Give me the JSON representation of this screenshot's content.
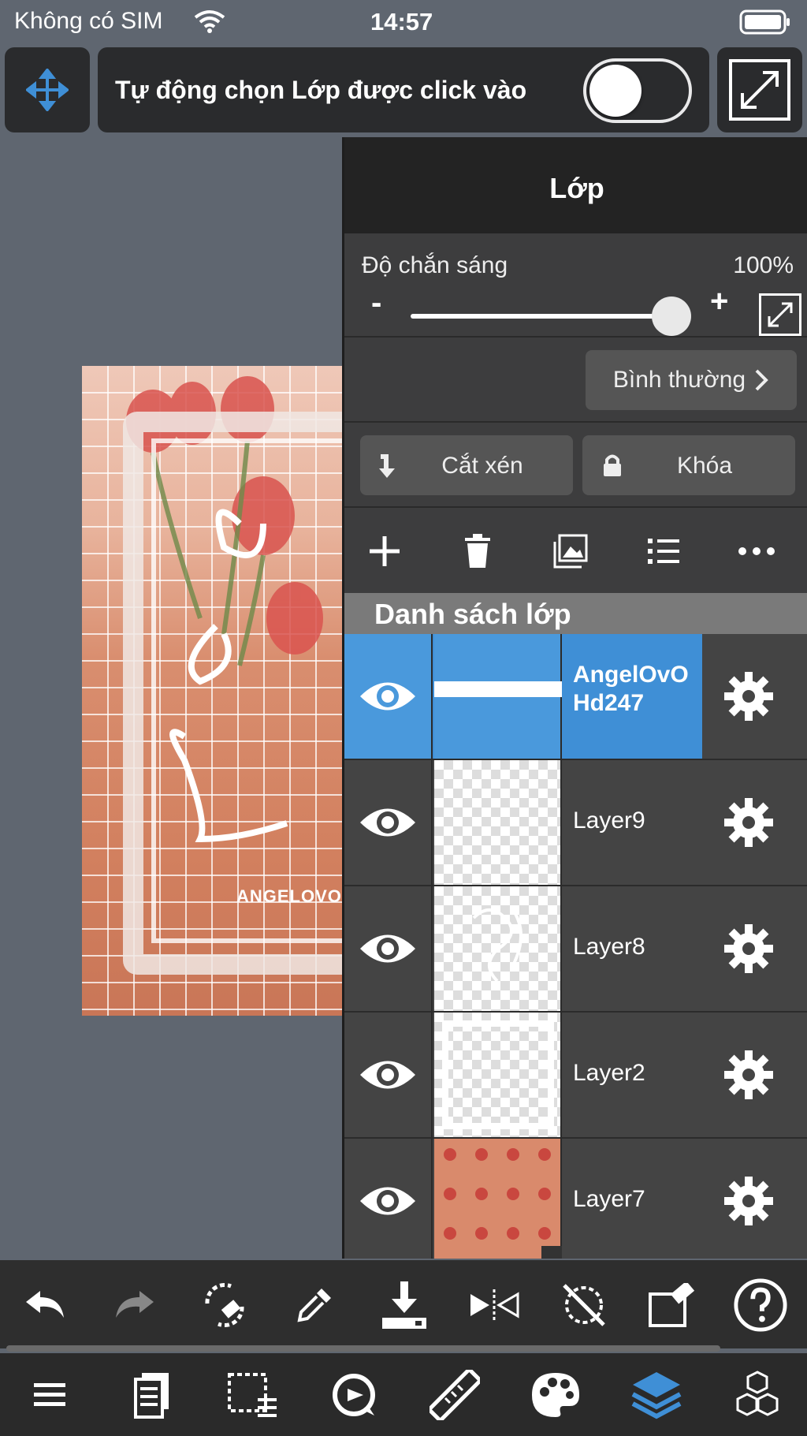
{
  "status_bar": {
    "carrier": "Không có SIM",
    "time": "14:57"
  },
  "top_bar": {
    "auto_select_label": "Tự động chọn Lớp được click vào",
    "auto_select_on": false
  },
  "artwork": {
    "caption": "ANGELOVO I"
  },
  "layer_panel": {
    "title": "Lớp",
    "opacity_label": "Độ chắn sáng",
    "opacity_value": "100%",
    "opacity_level": 1.0,
    "minus": "-",
    "plus": "+",
    "blend_mode": "Bình thường",
    "clipping_label": "Cắt xén",
    "lock_label": "Khóa",
    "list_header": "Danh sách lớp",
    "layers": [
      {
        "name": "AngelOvO Hd247",
        "selected": true,
        "visible": true
      },
      {
        "name": "Layer9",
        "selected": false,
        "visible": true
      },
      {
        "name": "Layer8",
        "selected": false,
        "visible": true
      },
      {
        "name": "Layer2",
        "selected": false,
        "visible": true
      },
      {
        "name": "Layer7",
        "selected": false,
        "visible": true
      }
    ]
  },
  "colors": {
    "accent": "#3f8fd6",
    "panel_bg": "#3d3d3e",
    "toolbar_bg": "#2e2e2e"
  }
}
